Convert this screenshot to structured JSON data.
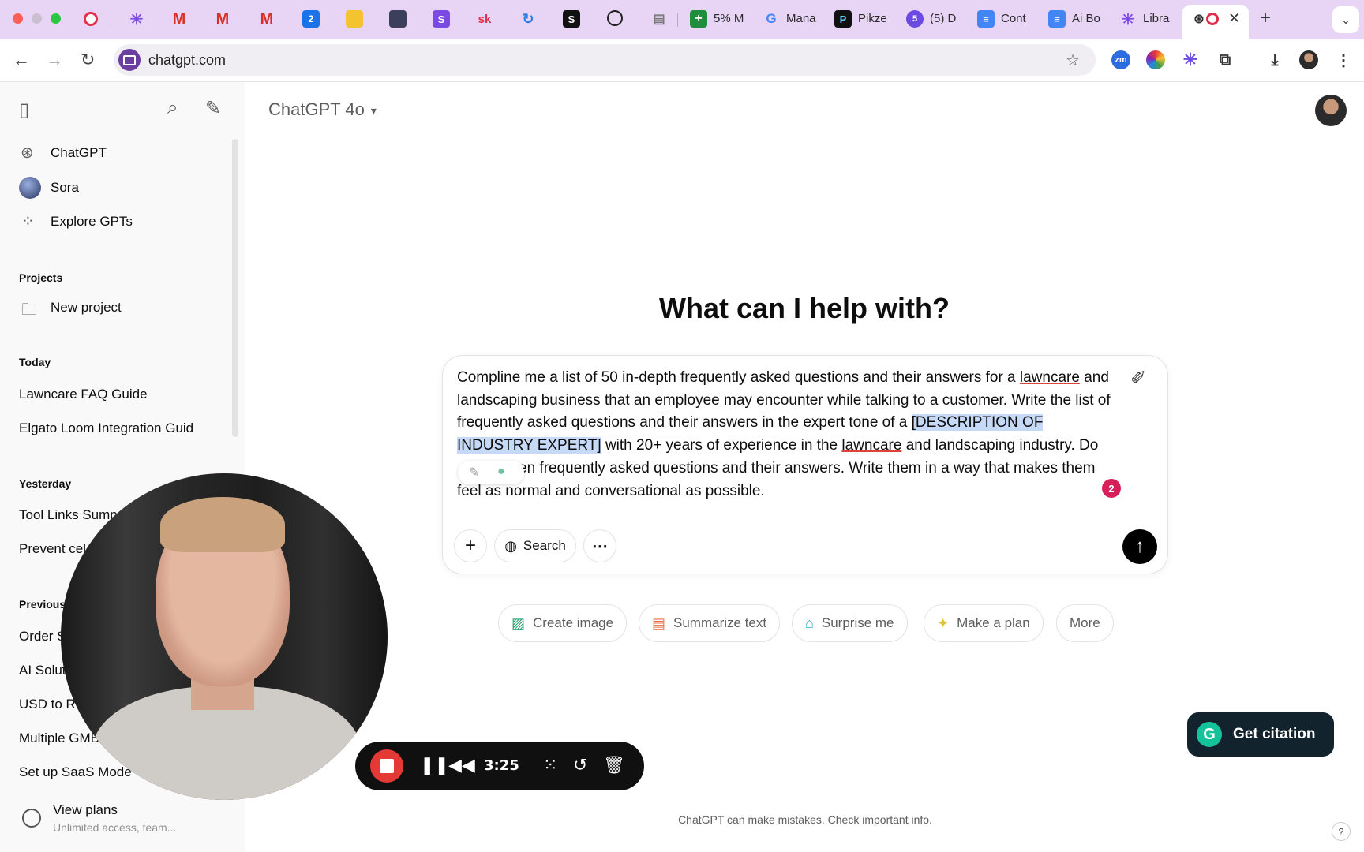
{
  "browser": {
    "tabs": [
      {
        "icon": "loom-record-icon",
        "label": ""
      },
      {
        "icon": "claude-icon",
        "label": ""
      },
      {
        "icon": "gmail-icon",
        "label": ""
      },
      {
        "icon": "gmail-icon",
        "label": ""
      },
      {
        "icon": "gmail-icon",
        "label": ""
      },
      {
        "icon": "calendar-icon",
        "label": ""
      },
      {
        "icon": "notes-icon",
        "label": ""
      },
      {
        "icon": "app-icon",
        "label": ""
      },
      {
        "icon": "s-icon",
        "label": ""
      },
      {
        "icon": "sk-icon",
        "label": ""
      },
      {
        "icon": "sync-icon",
        "label": ""
      },
      {
        "icon": "squarespace-icon",
        "label": ""
      },
      {
        "icon": "perplexity-icon",
        "label": ""
      },
      {
        "icon": "reader-icon",
        "label": ""
      },
      {
        "icon": "sheets-icon",
        "label": "5% M"
      },
      {
        "icon": "google-icon",
        "label": "Mana"
      },
      {
        "icon": "pikzels-icon",
        "label": "Pikze"
      },
      {
        "icon": "notification-icon",
        "label": "(5) D"
      },
      {
        "icon": "docs-icon",
        "label": "Cont"
      },
      {
        "icon": "docs-icon",
        "label": "Ai Bo"
      },
      {
        "icon": "claude-icon",
        "label": "Libra"
      }
    ],
    "url": "chatgpt.com"
  },
  "sidebar": {
    "nav": [
      {
        "label": "ChatGPT",
        "icon": "openai-icon"
      },
      {
        "label": "Sora",
        "icon": "sora-icon"
      },
      {
        "label": "Explore GPTs",
        "icon": "grid-icon"
      }
    ],
    "projects_title": "Projects",
    "new_project": "New project",
    "today_title": "Today",
    "today": [
      "Lawncare FAQ Guide",
      "Elgato Loom Integration Guid"
    ],
    "yesterday_title": "Yesterday",
    "yesterday": [
      "Tool Links Sump",
      "Prevent cel"
    ],
    "previous_title": "Previous",
    "previous": [
      "Order S",
      "AI Solut",
      "USD to R",
      "Multiple GMB",
      "Set up SaaS Mode"
    ],
    "plans_title": "View plans",
    "plans_sub": "Unlimited access, team..."
  },
  "main": {
    "model": "ChatGPT 4o",
    "heading": "What can I help with?",
    "prompt": {
      "p1": "Compline me a list of 50 in-depth frequently asked questions and their answers for a ",
      "w1": "lawncare",
      "p2": " and landscaping business that an employee may encounter while talking to a customer. Write the list of frequently asked questions and their answers in the expert tone of a ",
      "sel": "[DESCRIPTION OF INDUSTRY EXPERT]",
      "p3": " with 20+ years of experience in the ",
      "w2": "lawncare",
      "p4": " and landscaping industry. Do ",
      "p5": "en frequently asked questions and their answers. Write them in a way that makes them feel as normal and conversational as possible."
    },
    "grammarly_count": "2",
    "search_label": "Search",
    "chips": [
      {
        "label": "Create image",
        "icon": "image-icon",
        "color": "#22a06b"
      },
      {
        "label": "Summarize text",
        "icon": "document-icon",
        "color": "#e8704a"
      },
      {
        "label": "Surprise me",
        "icon": "gift-icon",
        "color": "#3aa6d8"
      },
      {
        "label": "Make a plan",
        "icon": "lightbulb-icon",
        "color": "#e2c13b"
      },
      {
        "label": "More",
        "icon": "",
        "color": ""
      }
    ],
    "footer": "ChatGPT can make mistakes. Check important info.",
    "citation": "Get citation"
  },
  "recorder": {
    "time": "3:25"
  }
}
